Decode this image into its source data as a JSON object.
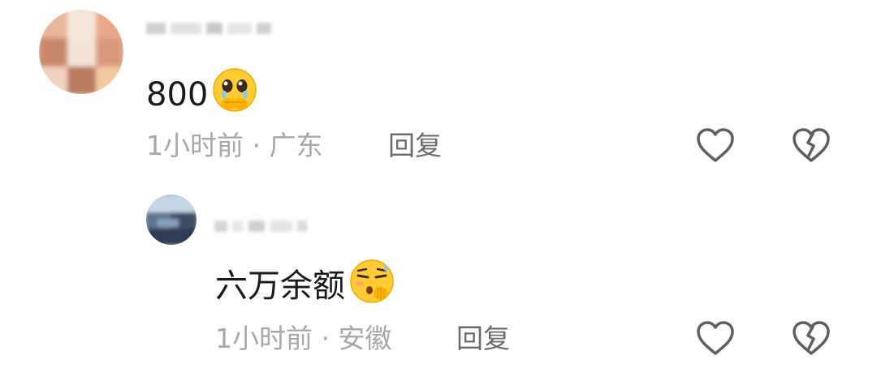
{
  "comments": [
    {
      "text": "800",
      "emoji": "pleading-face-hands-emoji",
      "time": "1小时前",
      "separator": " · ",
      "location": "广东",
      "reply_label": "回复",
      "like_icon": "heart-outline-icon",
      "dislike_icon": "broken-heart-outline-icon"
    },
    {
      "text": "六万余额",
      "emoji": "shushing-sweat-face-emoji",
      "time": "1小时前",
      "separator": " · ",
      "location": "安徽",
      "reply_label": "回复",
      "like_icon": "heart-outline-icon",
      "dislike_icon": "broken-heart-outline-icon"
    }
  ],
  "colors": {
    "text": "#1a1a1a",
    "meta": "#a8a8a8",
    "reply": "#6b6b6b",
    "icon": "#5f5f5f",
    "emoji_yellow": "#ffcc33"
  }
}
